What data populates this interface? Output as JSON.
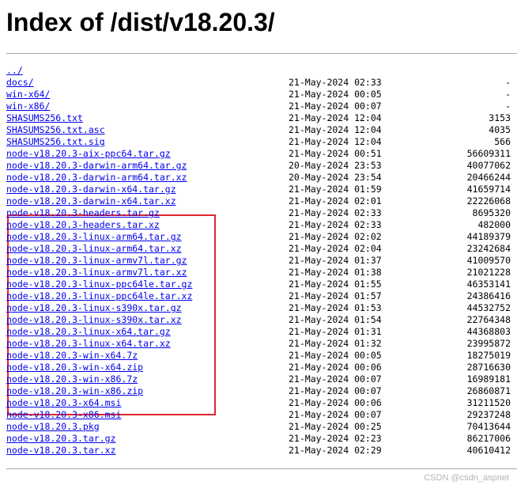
{
  "title": "Index of /dist/v18.20.3/",
  "watermark": "CSDN @csdn_aspnet",
  "colors": {
    "link": "#0000ee",
    "highlight_border": "#e0262e",
    "rule": "#a8a8a8"
  },
  "entries": [
    {
      "name": "../",
      "date": "",
      "size": ""
    },
    {
      "name": "docs/",
      "date": "21-May-2024 02:33",
      "size": "-"
    },
    {
      "name": "win-x64/",
      "date": "21-May-2024 00:05",
      "size": "-"
    },
    {
      "name": "win-x86/",
      "date": "21-May-2024 00:07",
      "size": "-"
    },
    {
      "name": "SHASUMS256.txt",
      "date": "21-May-2024 12:04",
      "size": "3153"
    },
    {
      "name": "SHASUMS256.txt.asc",
      "date": "21-May-2024 12:04",
      "size": "4035"
    },
    {
      "name": "SHASUMS256.txt.sig",
      "date": "21-May-2024 12:04",
      "size": "566"
    },
    {
      "name": "node-v18.20.3-aix-ppc64.tar.gz",
      "date": "21-May-2024 00:51",
      "size": "56609311"
    },
    {
      "name": "node-v18.20.3-darwin-arm64.tar.gz",
      "date": "20-May-2024 23:53",
      "size": "40077062"
    },
    {
      "name": "node-v18.20.3-darwin-arm64.tar.xz",
      "date": "20-May-2024 23:54",
      "size": "20466244"
    },
    {
      "name": "node-v18.20.3-darwin-x64.tar.gz",
      "date": "21-May-2024 01:59",
      "size": "41659714"
    },
    {
      "name": "node-v18.20.3-darwin-x64.tar.xz",
      "date": "21-May-2024 02:01",
      "size": "22226068"
    },
    {
      "name": "node-v18.20.3-headers.tar.gz",
      "date": "21-May-2024 02:33",
      "size": "8695320"
    },
    {
      "name": "node-v18.20.3-headers.tar.xz",
      "date": "21-May-2024 02:33",
      "size": "482000"
    },
    {
      "name": "node-v18.20.3-linux-arm64.tar.gz",
      "date": "21-May-2024 02:02",
      "size": "44189379"
    },
    {
      "name": "node-v18.20.3-linux-arm64.tar.xz",
      "date": "21-May-2024 02:04",
      "size": "23242684"
    },
    {
      "name": "node-v18.20.3-linux-armv7l.tar.gz",
      "date": "21-May-2024 01:37",
      "size": "41009570"
    },
    {
      "name": "node-v18.20.3-linux-armv7l.tar.xz",
      "date": "21-May-2024 01:38",
      "size": "21021228"
    },
    {
      "name": "node-v18.20.3-linux-ppc64le.tar.gz",
      "date": "21-May-2024 01:55",
      "size": "46353141"
    },
    {
      "name": "node-v18.20.3-linux-ppc64le.tar.xz",
      "date": "21-May-2024 01:57",
      "size": "24386416"
    },
    {
      "name": "node-v18.20.3-linux-s390x.tar.gz",
      "date": "21-May-2024 01:53",
      "size": "44532752"
    },
    {
      "name": "node-v18.20.3-linux-s390x.tar.xz",
      "date": "21-May-2024 01:54",
      "size": "22764348"
    },
    {
      "name": "node-v18.20.3-linux-x64.tar.gz",
      "date": "21-May-2024 01:31",
      "size": "44368803"
    },
    {
      "name": "node-v18.20.3-linux-x64.tar.xz",
      "date": "21-May-2024 01:32",
      "size": "23995872"
    },
    {
      "name": "node-v18.20.3-win-x64.7z",
      "date": "21-May-2024 00:05",
      "size": "18275019"
    },
    {
      "name": "node-v18.20.3-win-x64.zip",
      "date": "21-May-2024 00:06",
      "size": "28716630"
    },
    {
      "name": "node-v18.20.3-win-x86.7z",
      "date": "21-May-2024 00:07",
      "size": "16989181"
    },
    {
      "name": "node-v18.20.3-win-x86.zip",
      "date": "21-May-2024 00:07",
      "size": "26860871"
    },
    {
      "name": "node-v18.20.3-x64.msi",
      "date": "21-May-2024 00:06",
      "size": "31211520"
    },
    {
      "name": "node-v18.20.3-x86.msi",
      "date": "21-May-2024 00:07",
      "size": "29237248"
    },
    {
      "name": "node-v18.20.3.pkg",
      "date": "21-May-2024 00:25",
      "size": "70413644"
    },
    {
      "name": "node-v18.20.3.tar.gz",
      "date": "21-May-2024 02:23",
      "size": "86217006"
    },
    {
      "name": "node-v18.20.3.tar.xz",
      "date": "21-May-2024 02:29",
      "size": "40610412"
    }
  ]
}
